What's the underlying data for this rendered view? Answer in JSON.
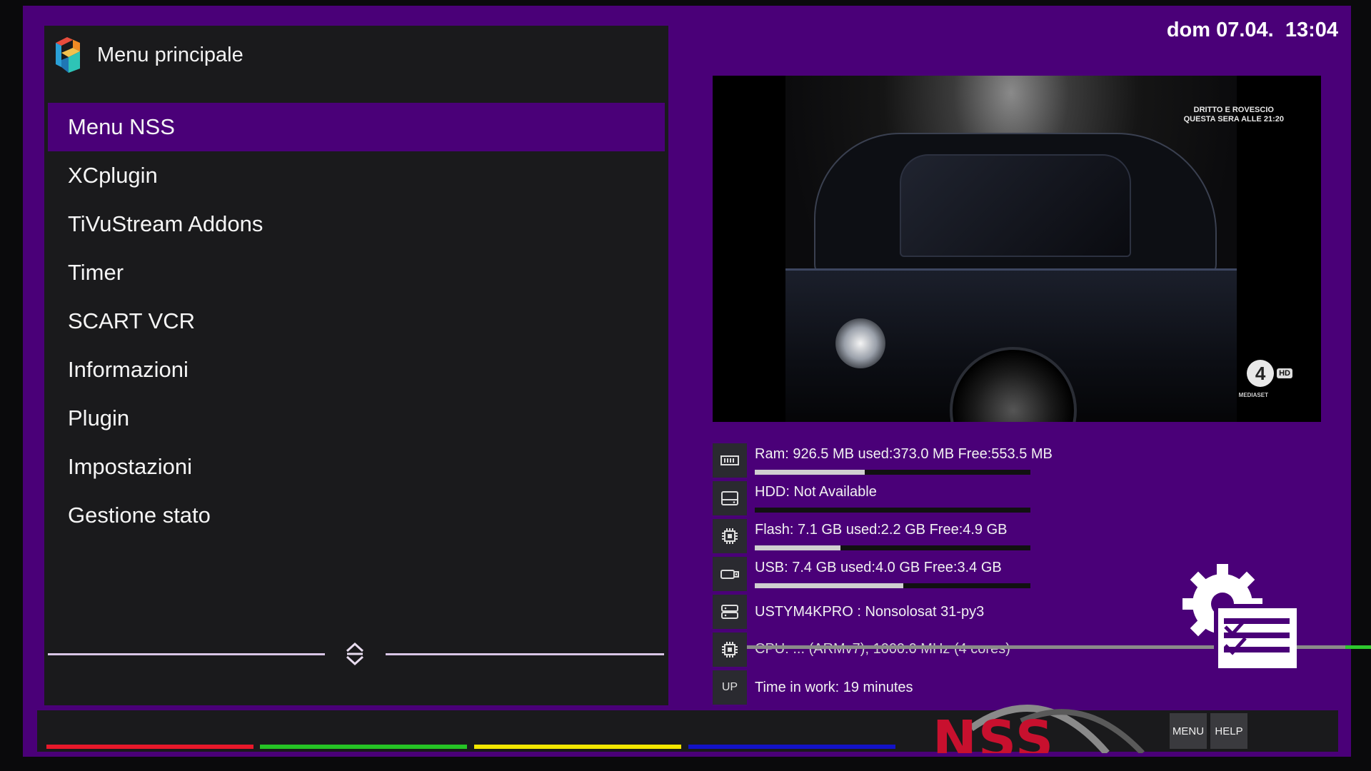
{
  "clock": "dom 07.04.  13:04",
  "menu": {
    "title": "Menu principale",
    "items": [
      {
        "label": "Menu NSS",
        "selected": true
      },
      {
        "label": "XCplugin"
      },
      {
        "label": "TiVuStream Addons"
      },
      {
        "label": "Timer"
      },
      {
        "label": "SCART VCR"
      },
      {
        "label": "Informazioni"
      },
      {
        "label": "Plugin"
      },
      {
        "label": "Impostazioni"
      },
      {
        "label": "Gestione stato"
      }
    ]
  },
  "tv": {
    "caption_line1": "DRITTO E ROVESCIO",
    "caption_line2": "QUESTA SERA ALLE 21:20",
    "channel_number": "4",
    "channel_hd": "HD",
    "channel_network": "MEDIASET"
  },
  "info": {
    "ram": {
      "icon": "ram-icon",
      "text": "Ram: 926.5 MB used:373.0 MB Free:553.5 MB",
      "used_fraction": 0.4
    },
    "hdd": {
      "icon": "hdd-icon",
      "text": "HDD: Not Available",
      "used_fraction": 0
    },
    "flash": {
      "icon": "chip-icon",
      "text": "Flash: 7.1 GB used:2.2 GB Free:4.9 GB",
      "used_fraction": 0.31
    },
    "usb": {
      "icon": "usb-icon",
      "text": "USB: 7.4 GB used:4.0 GB Free:3.4 GB",
      "used_fraction": 0.54
    },
    "box": {
      "icon": "server-icon",
      "text": "USTYM4KPRO : Nonsolosat 31-py3"
    },
    "cpu": {
      "icon": "cpu-icon",
      "text": "CPU: ... (ARMv7), 1000.0 MHz (4 cores)"
    },
    "uptime": {
      "icon_label": "UP",
      "text": "Time in work: 19 minutes"
    }
  },
  "footer": {
    "logo_text": "NSS",
    "color_keys": {
      "red": "#e8182a",
      "green": "#25c425",
      "yellow": "#f2e600",
      "blue": "#1212c8"
    },
    "menu_key": "MENU",
    "help_key": "HELP"
  }
}
